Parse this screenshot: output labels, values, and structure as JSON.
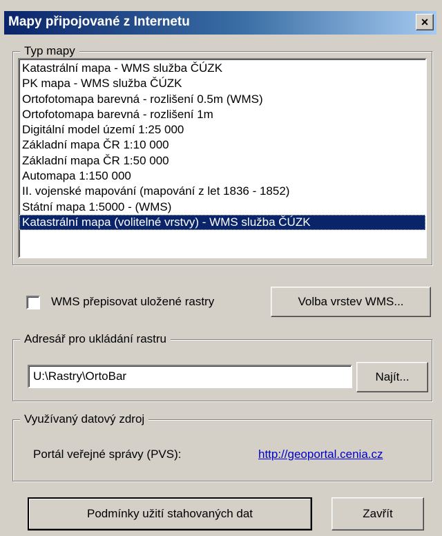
{
  "window": {
    "title": "Mapy připojované z  Internetu",
    "close_label": "×"
  },
  "map_type": {
    "legend": "Typ mapy",
    "items": [
      "Katastrální mapa - WMS služba ČÚZK",
      "PK mapa - WMS služba ČÚZK",
      "Ortofotomapa barevná - rozlišení 0.5m (WMS)",
      "Ortofotomapa barevná - rozlišení 1m",
      "Digitální model území 1:25 000",
      "Základní mapa ČR 1:10 000",
      "Základní mapa ČR 1:50 000",
      "Automapa 1:150 000",
      "II. vojenské mapování  (mapování z let 1836 - 1852)",
      "Státní mapa 1:5000 - (WMS)",
      "Katastrální mapa (volitelné vrstvy) - WMS služba ČÚZK"
    ],
    "selected_index": 10
  },
  "wms": {
    "checkbox_label": "WMS přepisovat uložené rastry",
    "checked": false,
    "layers_button": "Volba vrstev WMS..."
  },
  "directory": {
    "legend": "Adresář pro ukládání rastru",
    "path": "U:\\Rastry\\OrtoBar",
    "find_button": "Najít..."
  },
  "source": {
    "legend": "Využívaný datový zdroj",
    "label": "Portál veřejné správy (PVS):",
    "link": "http://geoportal.cenia.cz"
  },
  "footer": {
    "terms_button": "Podmínky užití stahovaných dat",
    "close_button": "Zavřít"
  },
  "colors": {
    "dialog_bg": "#d4d0c8",
    "selection": "#0a246a",
    "titlebar_start": "#0a246a",
    "titlebar_end": "#a6caf0",
    "link": "#0000cc"
  }
}
